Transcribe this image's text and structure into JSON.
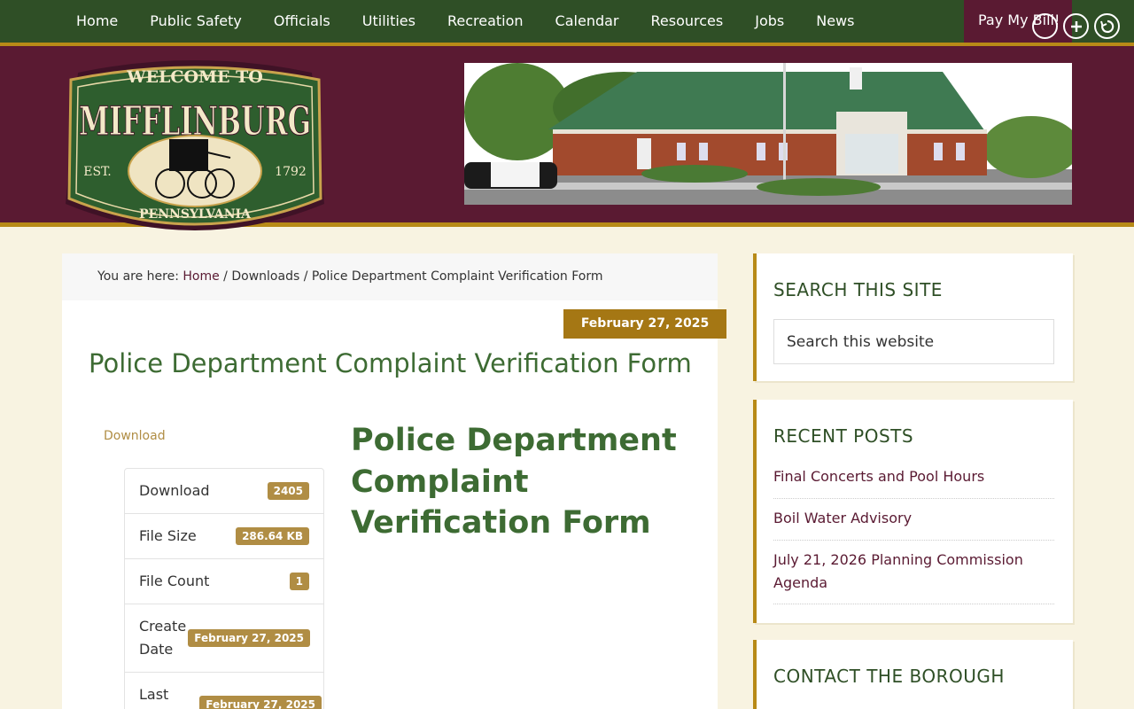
{
  "nav": {
    "items": [
      "Home",
      "Public Safety",
      "Officials",
      "Utilities",
      "Recreation",
      "Calendar",
      "Resources",
      "Jobs",
      "News"
    ],
    "pay_bill": "Pay My Bill!",
    "a11y_icons": [
      "contrast-icon",
      "zoom-in-icon",
      "reset-icon"
    ]
  },
  "logo": {
    "top_text": "WELCOME TO",
    "name": "MIFFLINBURG",
    "est_left": "EST.",
    "est_right": "1792",
    "bottom_text": "PENNSYLVANIA"
  },
  "breadcrumb": {
    "prefix": "You are here: ",
    "home": "Home",
    "sep1": " / ",
    "downloads": "Downloads",
    "sep2": " / ",
    "current": "Police Department Complaint Verification Form"
  },
  "post": {
    "date": "February 27, 2025",
    "title": "Police Department Complaint Verification Form",
    "download_link": "Download",
    "heading": "Police Department Complaint Verification Form"
  },
  "info": {
    "download_label": "Download",
    "download_count": "2405",
    "file_size_label": "File Size",
    "file_size": "286.64 KB",
    "file_count_label": "File Count",
    "file_count": "1",
    "create_date_label_1": "Create",
    "create_date_label_2": "Date",
    "create_date": "February 27, 2025",
    "last_label": "Last",
    "last_date": "February 27, 2025"
  },
  "sidebar": {
    "search_title": "SEARCH THIS SITE",
    "search_placeholder": "Search this website",
    "recent_title": "RECENT POSTS",
    "recent_posts": [
      "Final Concerts and Pool Hours",
      "Boil Water Advisory",
      "July 21, 2026 Planning Commission Agenda"
    ],
    "contact_title": "CONTACT THE BOROUGH"
  },
  "colors": {
    "nav_green": "#2f4f26",
    "maroon": "#5a1a32",
    "gold": "#b88a17",
    "title_green": "#3d6b33",
    "badge_tan": "#b08d44"
  }
}
